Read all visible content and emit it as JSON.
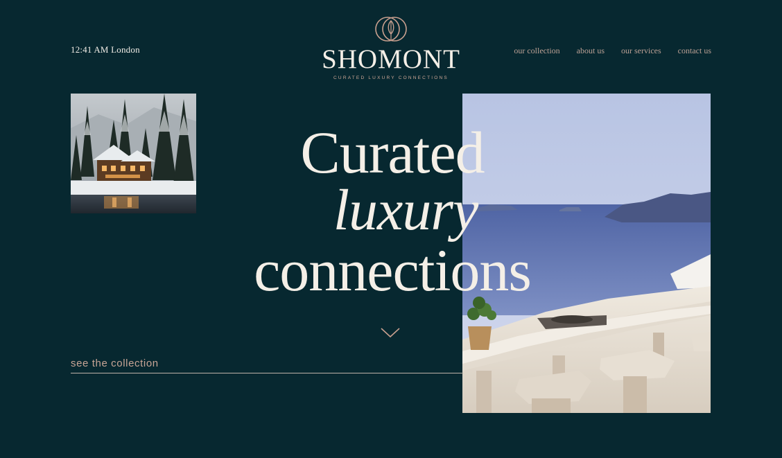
{
  "header": {
    "clock": "12:41 AM London",
    "brand": {
      "name": "SHOMONT",
      "tagline": "CURATED LUXURY CONNECTIONS"
    },
    "nav": [
      {
        "label": "our collection"
      },
      {
        "label": "about us"
      },
      {
        "label": "our services"
      },
      {
        "label": "contact us"
      }
    ]
  },
  "hero": {
    "line1": "Curated",
    "line2": "luxury",
    "line3": "connections"
  },
  "cta": {
    "label": "see the collection"
  },
  "icons": {
    "logo": "interlocking-rings-logo-icon",
    "scroll": "chevron-down-icon"
  },
  "colors": {
    "background": "#072830",
    "text": "#f4efe7",
    "accent": "#c8a596"
  }
}
